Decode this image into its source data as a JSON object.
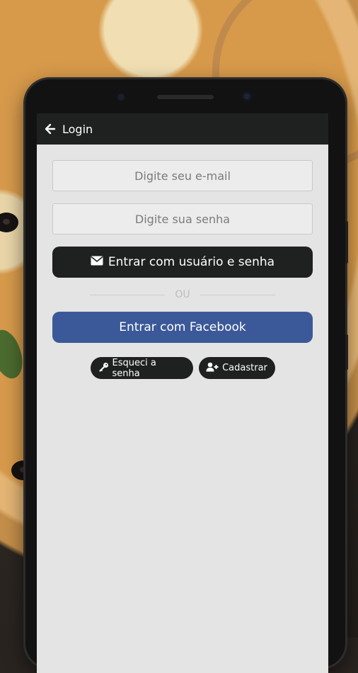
{
  "app_bar": {
    "back_icon": "arrow-left-icon",
    "title": "Login"
  },
  "form": {
    "email_placeholder": "Digite seu e-mail",
    "email_value": "",
    "password_placeholder": "Digite sua senha",
    "password_value": ""
  },
  "buttons": {
    "login_icon": "envelope-icon",
    "login_label": "Entrar com usuário e senha",
    "divider_text": "OU",
    "facebook_label": "Entrar com Facebook",
    "forgot_icon": "key-icon",
    "forgot_label": "Esqueci a senha",
    "register_icon": "user-plus-icon",
    "register_label": "Cadastrar"
  },
  "colors": {
    "app_bar": "#1f2020",
    "screen_background": "#e4e4e4",
    "facebook": "#3b5998",
    "dark_button": "#1f2020"
  }
}
